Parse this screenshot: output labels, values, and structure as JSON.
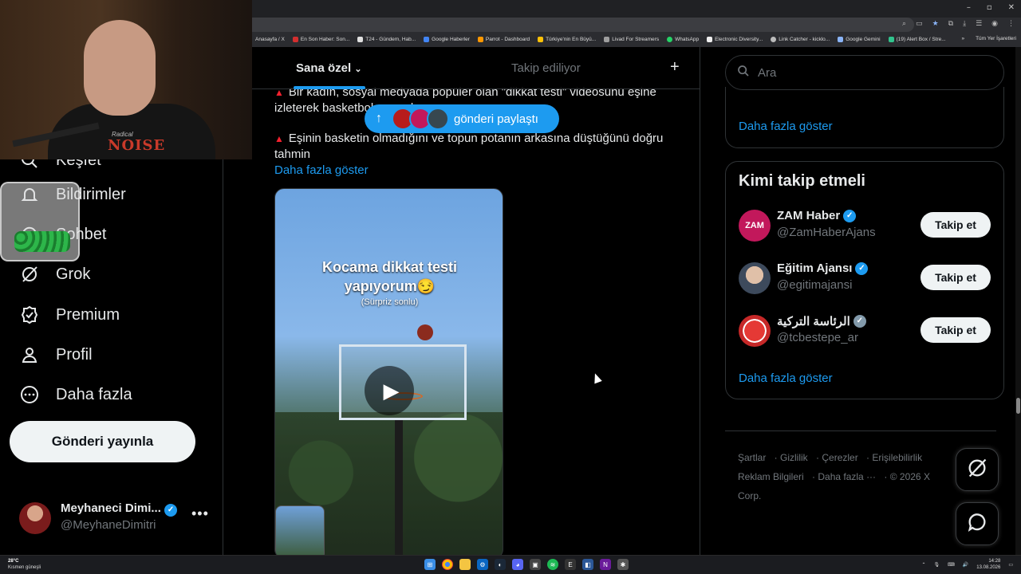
{
  "browser": {
    "window_controls": [
      "–",
      "▫",
      "✕"
    ],
    "bookmarks": [
      "Anasayfa / X",
      "En Son Haber: Son...",
      "T24 - Gündem, Hab...",
      "Google Haberler",
      "Parrot - Dashboard",
      "Türkiye'nin En Büyü...",
      "Livad For Streamers",
      "WhatsApp",
      "Electronic Diversity...",
      "Link Catcher - kicklo...",
      "Google Gemini",
      "(19) Alert Box / Stre..."
    ],
    "bookmarks_overflow": "»",
    "all_bookmarks": "Tüm Yer İşaretleri"
  },
  "webcam": {
    "shirt_top": "Radical",
    "shirt_main": "NOISE"
  },
  "sidebar": {
    "items": [
      {
        "label": "Keşfet",
        "icon": "search-icon"
      },
      {
        "label": "Bildirimler",
        "icon": "bell-icon"
      },
      {
        "label": "Sohbet",
        "icon": "chat-icon"
      },
      {
        "label": "Grok",
        "icon": "grok-icon"
      },
      {
        "label": "Premium",
        "icon": "verified-badge-icon"
      },
      {
        "label": "Profil",
        "icon": "person-icon"
      },
      {
        "label": "Daha fazla",
        "icon": "more-circle-icon"
      }
    ],
    "post_button": "Gönderi yayınla",
    "account": {
      "name": "Meyhaneci Dimi...",
      "handle": "@MeyhaneDimitri",
      "more": "•••"
    }
  },
  "main": {
    "tabs": [
      {
        "label": "Sana özel",
        "active": true
      },
      {
        "label": "Takip ediliyor",
        "active": false
      }
    ],
    "tab_add": "+",
    "post": {
      "line1": "Bir kadın, sosyal medyada popüler olan \"dikkat testi\" videosunu eşine",
      "line2": "izleterek basketbol ... sordu.",
      "bullet2": "Eşinin basketin olmadığını ve topun potanın arkasına düştüğünü doğru tahmin",
      "show_more": "Daha fazla göster"
    },
    "new_posts_pill": {
      "arrow": "↑",
      "label": "gönderi paylaştı"
    },
    "video": {
      "caption_line1": "Kocama dikkat testi",
      "caption_line2": "yapıyorum😏",
      "sub": "(Sürpriz sonlu)",
      "play": "▶"
    }
  },
  "right": {
    "search_placeholder": "Ara",
    "top_card_more": "Daha fazla göster",
    "who_to_follow": {
      "title": "Kimi takip etmeli",
      "users": [
        {
          "name": "ZAM Haber",
          "handle": "@ZamHaberAjans",
          "avatar_text": "ZAM",
          "avatar_color": "#c2185b",
          "verified_color": "#1d9bf0",
          "button": "Takip et"
        },
        {
          "name": "Eğitim Ajansı",
          "handle": "@egitimajansi",
          "avatar_text": "",
          "avatar_color": "#7a8a99",
          "verified_color": "#1d9bf0",
          "button": "Takip et"
        },
        {
          "name": "الرئاسة التركية",
          "handle": "@tcbestepe_ar",
          "avatar_text": "",
          "avatar_color": "#d32f2f",
          "verified_color": "#829aab",
          "button": "Takip et"
        }
      ],
      "more": "Daha fazla göster"
    },
    "footer": [
      "Şartlar",
      "Gizlilik",
      "Çerezler",
      "Erişilebilirlik",
      "Reklam Bilgileri",
      "Daha fazla ···",
      "© 2026 X Corp."
    ]
  },
  "taskbar": {
    "temp": "28°C",
    "weather": "Kısmen güneşli",
    "time": "14:28",
    "date": "13.08.2026"
  },
  "colors": {
    "accent": "#1d9bf0",
    "text": "#e7e9ea",
    "muted": "#71767b",
    "border": "#2f3336",
    "alert": "#f4212e"
  }
}
